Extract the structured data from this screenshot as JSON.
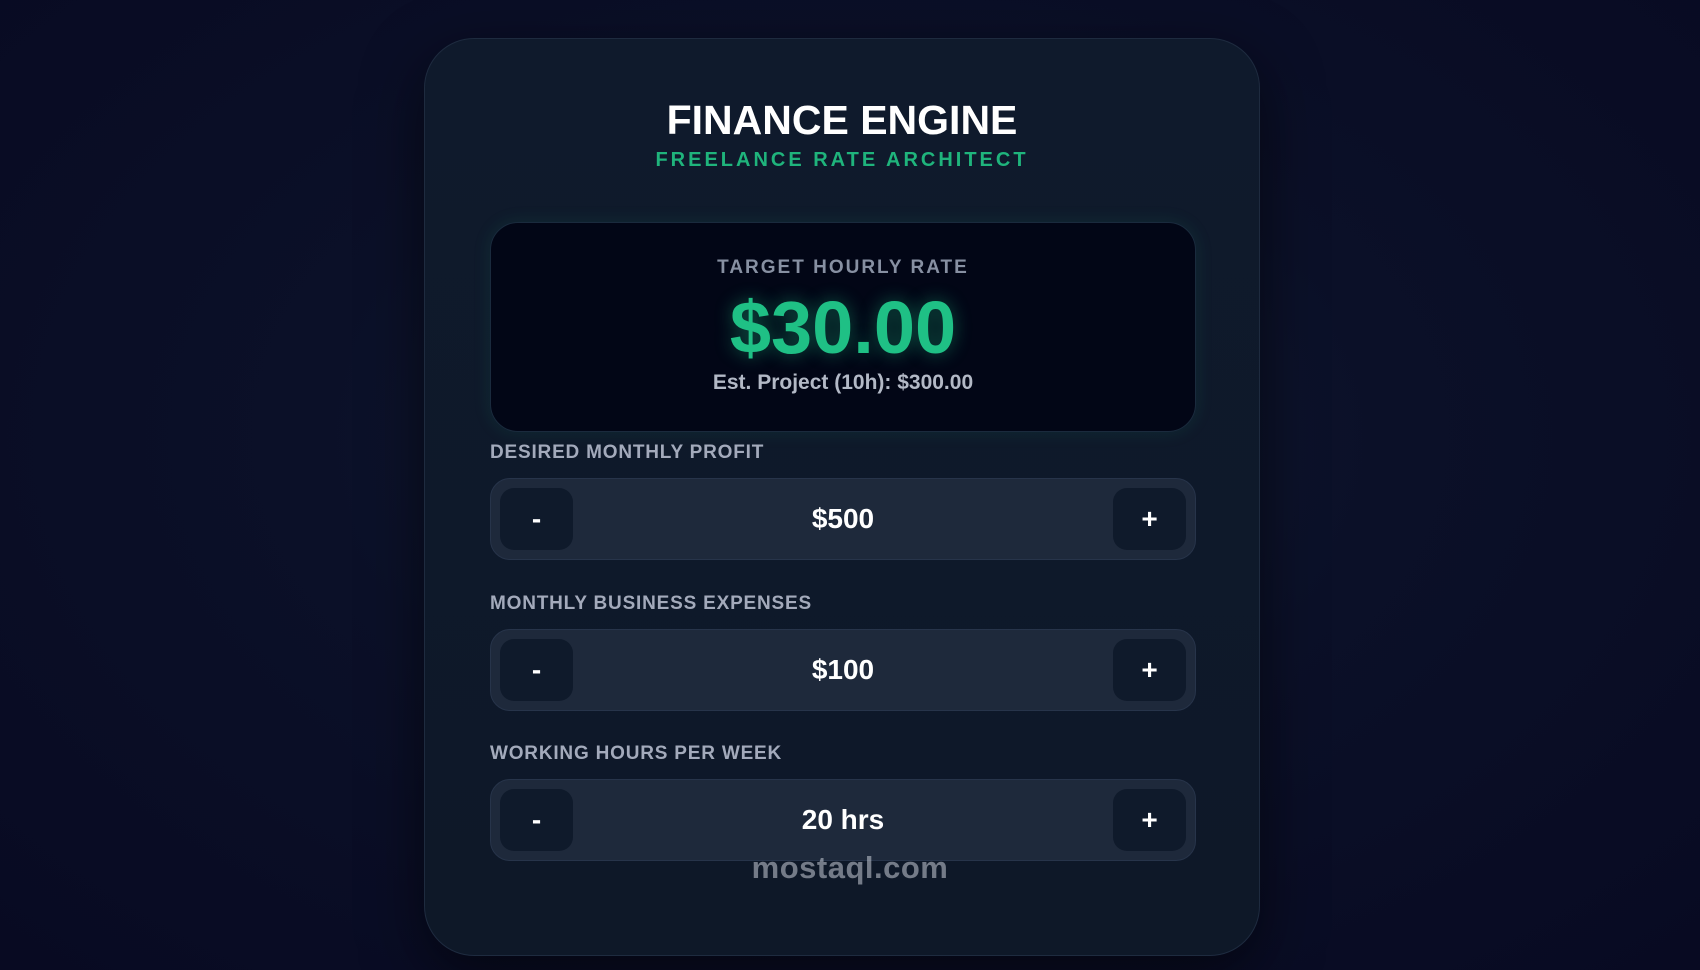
{
  "header": {
    "title": "FINANCE ENGINE",
    "subtitle": "FREELANCE RATE ARCHITECT"
  },
  "result": {
    "label": "TARGET HOURLY RATE",
    "value": "$30.00",
    "estimate": "Est. Project (10h): $300.00"
  },
  "fields": [
    {
      "label": "DESIRED MONTHLY PROFIT",
      "value": "$500",
      "minus": "-",
      "plus": "+"
    },
    {
      "label": "MONTHLY BUSINESS EXPENSES",
      "value": "$100",
      "minus": "-",
      "plus": "+"
    },
    {
      "label": "WORKING HOURS PER WEEK",
      "value": "20 hrs",
      "minus": "-",
      "plus": "+"
    }
  ],
  "watermark": {
    "text": "mostaql.com"
  },
  "colors": {
    "accent": "#1fc085",
    "card": "#0f1a2c",
    "stepper": "#1e293b",
    "button": "#0f1a2b"
  }
}
